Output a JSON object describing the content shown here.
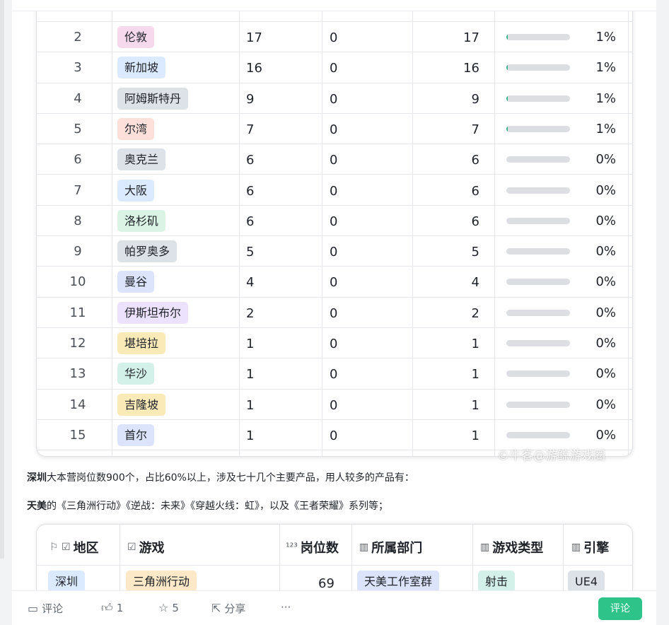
{
  "city_table": {
    "rows": [
      {
        "index": "2",
        "city": "伦敦",
        "tag_color": "#f7d9ee",
        "total": "17",
        "zero": "0",
        "count": "17",
        "fill": 0.01,
        "pct": "1%"
      },
      {
        "index": "3",
        "city": "新加坡",
        "tag_color": "#dbeaff",
        "total": "16",
        "zero": "0",
        "count": "16",
        "fill": 0.01,
        "pct": "1%"
      },
      {
        "index": "4",
        "city": "阿姆斯特丹",
        "tag_color": "#dde1e8",
        "total": "9",
        "zero": "0",
        "count": "9",
        "fill": 0.01,
        "pct": "1%"
      },
      {
        "index": "5",
        "city": "尔湾",
        "tag_color": "#fde0da",
        "total": "7",
        "zero": "0",
        "count": "7",
        "fill": 0.01,
        "pct": "1%"
      },
      {
        "index": "6",
        "city": "奥克兰",
        "tag_color": "#dde1e8",
        "total": "6",
        "zero": "0",
        "count": "6",
        "fill": 0,
        "pct": "0%"
      },
      {
        "index": "7",
        "city": "大阪",
        "tag_color": "#dbeaff",
        "total": "6",
        "zero": "0",
        "count": "6",
        "fill": 0,
        "pct": "0%"
      },
      {
        "index": "8",
        "city": "洛杉矶",
        "tag_color": "#daf3e4",
        "total": "6",
        "zero": "0",
        "count": "6",
        "fill": 0,
        "pct": "0%"
      },
      {
        "index": "9",
        "city": "帕罗奥多",
        "tag_color": "#dde1e8",
        "total": "5",
        "zero": "0",
        "count": "5",
        "fill": 0,
        "pct": "0%"
      },
      {
        "index": "10",
        "city": "曼谷",
        "tag_color": "#dbe4fb",
        "total": "4",
        "zero": "0",
        "count": "4",
        "fill": 0,
        "pct": "0%"
      },
      {
        "index": "11",
        "city": "伊斯坦布尔",
        "tag_color": "#ece2fd",
        "total": "2",
        "zero": "0",
        "count": "2",
        "fill": 0,
        "pct": "0%"
      },
      {
        "index": "12",
        "city": "堪培拉",
        "tag_color": "#faeab8",
        "total": "1",
        "zero": "0",
        "count": "1",
        "fill": 0,
        "pct": "0%"
      },
      {
        "index": "13",
        "city": "华沙",
        "tag_color": "#d4f1e9",
        "total": "1",
        "zero": "0",
        "count": "1",
        "fill": 0,
        "pct": "0%"
      },
      {
        "index": "14",
        "city": "吉隆坡",
        "tag_color": "#faeab8",
        "total": "1",
        "zero": "0",
        "count": "1",
        "fill": 0,
        "pct": "0%"
      },
      {
        "index": "15",
        "city": "首尔",
        "tag_color": "#dbe4fb",
        "total": "1",
        "zero": "0",
        "count": "1",
        "fill": 0,
        "pct": "0%"
      }
    ]
  },
  "watermark": "©牛客@游鲸游戏圈",
  "paragraphs": {
    "p1_bold": "深圳",
    "p1_rest": "大本营岗位数900个，占比60%以上，涉及七十几个主要产品，用人较多的产品有：",
    "p2_bold": "天美",
    "p2_rest": "的《三角洲行动》《逆战：未来》《穿越火线：虹》，以及《王者荣耀》系列等；"
  },
  "game_table": {
    "headers": [
      {
        "icon": "⚐ ☑",
        "label": "地区"
      },
      {
        "icon": "☑",
        "label": "游戏"
      },
      {
        "icon": "¹²³",
        "label": "岗位数"
      },
      {
        "icon": "▥",
        "label": "所属部门"
      },
      {
        "icon": "▥",
        "label": "游戏类型"
      },
      {
        "icon": "▥",
        "label": "引擎"
      }
    ],
    "row": {
      "region": "深圳",
      "region_color": "#dbeaff",
      "game": "三角洲行动",
      "game_color": "#fde8c7",
      "positions": "69",
      "department": "天美工作室群",
      "department_color": "#dbe4fb",
      "genre": "射击",
      "genre_color": "#d4f1e9",
      "engine": "UE4",
      "engine_color": "#dde1e8"
    }
  },
  "toolbar": {
    "comment_label": "评论",
    "like_count": "1",
    "favorite_count": "5",
    "share_label": "分享",
    "more_label": "···",
    "comment_button": "评论"
  },
  "colors": {
    "accent": "#2ec489",
    "progress": "#33b389"
  }
}
